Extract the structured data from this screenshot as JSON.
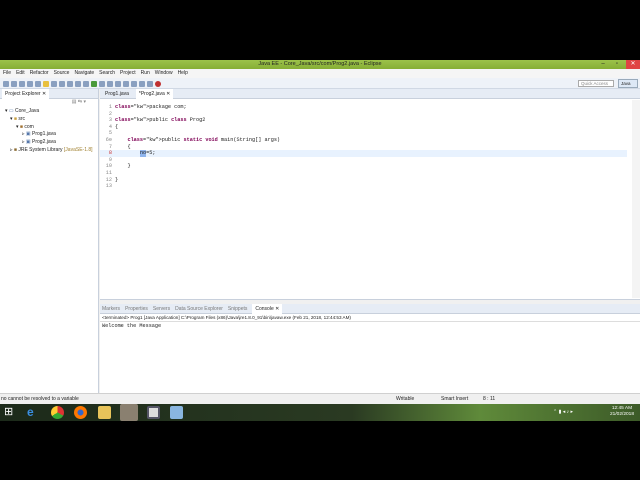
{
  "window": {
    "title": "Java EE - Core_Java/src/com/Prog2.java - Eclipse"
  },
  "menu": [
    "File",
    "Edit",
    "Refactor",
    "Source",
    "Navigate",
    "Search",
    "Project",
    "Run",
    "Window",
    "Help"
  ],
  "toolbar": {
    "quick_access": "Quick Access",
    "perspective": "Java EE"
  },
  "explorer": {
    "title": "Project Explorer",
    "tree": [
      {
        "label": "Core_Java",
        "indent": 1
      },
      {
        "label": "src",
        "indent": 2
      },
      {
        "label": "com",
        "indent": 3
      },
      {
        "label": "Prog1.java",
        "indent": 4
      },
      {
        "label": "Prog2.java",
        "indent": 4
      },
      {
        "label": "JRE System Library",
        "extra": "[JavaSE-1.8]",
        "indent": 2
      }
    ]
  },
  "editor": {
    "tabs": [
      "Prog1.java",
      "*Prog2.java"
    ],
    "lines": [
      {
        "n": "1",
        "code": "package com;"
      },
      {
        "n": "2",
        "code": ""
      },
      {
        "n": "3",
        "code": "public class Prog2"
      },
      {
        "n": "4",
        "code": "{"
      },
      {
        "n": "5",
        "code": ""
      },
      {
        "n": "6⊖",
        "code": "    public static void main(String[] args)"
      },
      {
        "n": "7",
        "code": "    {"
      },
      {
        "n": "8",
        "code": "        no=5;"
      },
      {
        "n": "9",
        "code": ""
      },
      {
        "n": "10",
        "code": "    }"
      },
      {
        "n": "11",
        "code": ""
      },
      {
        "n": "12",
        "code": "}"
      },
      {
        "n": "13",
        "code": ""
      }
    ]
  },
  "console": {
    "tabs": [
      "Markers",
      "Properties",
      "Servers",
      "Data Source Explorer",
      "Snippets",
      "Console"
    ],
    "header": "<terminated> Prog1 [Java Application] C:\\Program Files (x86)\\Java\\jre1.8.0_91\\bin\\javaw.exe (Feb 21, 2018, 12:44:53 AM)",
    "output": "Welcome the Message"
  },
  "status": {
    "message": "no cannot be resolved to a variable",
    "writable": "Writable",
    "mode": "Smart Insert",
    "position": "8 : 11"
  },
  "taskbar": {
    "time": "12:45 AM",
    "date": "21/02/2018"
  }
}
